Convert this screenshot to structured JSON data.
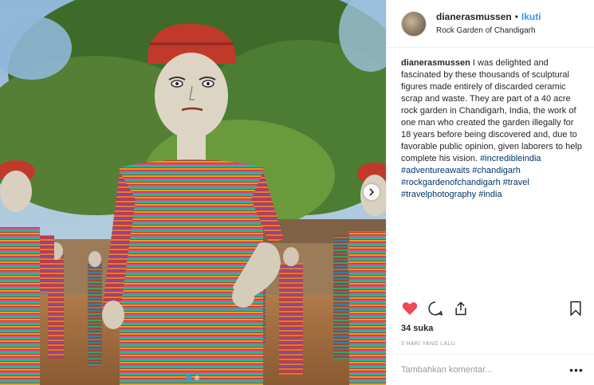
{
  "post": {
    "username": "dianerasmussen",
    "separator": "•",
    "follow_label": "Ikuti",
    "location": "Rock Garden of Chandigarh",
    "caption_text": "I was delighted and fascinated by these thousands of sculptural figures made entirely of discarded ceramic scrap and waste. They are part of a 40 acre rock garden in Chandigarh, India, the work of one man who created the garden illegally for 18 years before being discovered and, due to favorable public opinion, given laborers to help complete his vision.",
    "hashtags": "#incredibleindia #adventureawaits #chandigarh #rockgardenofchandigarh #travel #travelphotography #india",
    "likes": "34 suka",
    "time_ago": "3 HARI YANG LALU",
    "comment_placeholder": "Tambahkan komentar...",
    "more_label": "•••"
  },
  "icons": {
    "like": "heart-icon",
    "comment": "comment-icon",
    "share": "share-icon",
    "save": "bookmark-icon",
    "next": "chevron-right-icon"
  },
  "colors": {
    "liked": "#ed4956",
    "link": "#3897f0",
    "hashtag": "#003569"
  }
}
